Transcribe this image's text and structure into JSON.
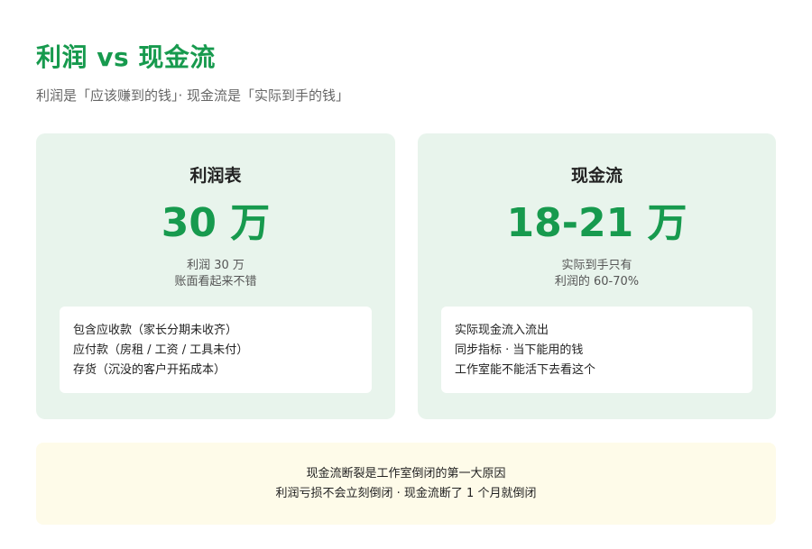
{
  "header": {
    "title": "利润 vs 现金流",
    "subtitle": "利润是「应该赚到的钱」· 现金流是「实际到手的钱」"
  },
  "cards": [
    {
      "title": "利润表",
      "value": "30 万",
      "desc": [
        "利润 30 万",
        "账面看起来不错"
      ],
      "items": [
        "包含应收款（家长分期未收齐）",
        "应付款（房租 / 工资 / 工具未付）",
        "存货（沉没的客户开拓成本）"
      ]
    },
    {
      "title": "现金流",
      "value": "18-21 万",
      "desc": [
        "实际到手只有",
        "利润的 60-70%"
      ],
      "items": [
        "实际现金流入流出",
        "同步指标 · 当下能用的钱",
        "工作室能不能活下去看这个"
      ]
    }
  ],
  "note": {
    "lines": [
      "现金流断裂是工作室倒闭的第一大原因",
      "利润亏损不会立刻倒闭 · 现金流断了 1 个月就倒闭"
    ]
  },
  "colors": {
    "accent": "#179a4e",
    "card_bg": "#e8f4ec",
    "note_bg": "#fefbe9"
  }
}
